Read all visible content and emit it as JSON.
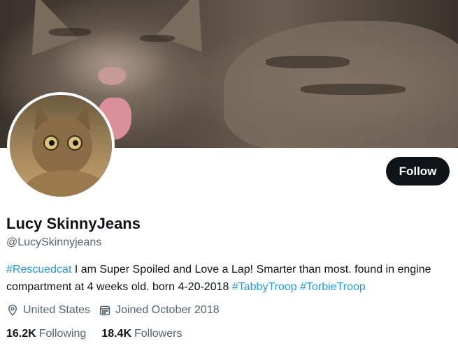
{
  "profile": {
    "display_name": "Lucy SkinnyJeans",
    "handle": "@LucySkinnyjeans",
    "follow_label": "Follow",
    "bio": {
      "tag1": "#Rescuedcat",
      "text1": " I am Super Spoiled and Love a Lap! Smarter than most. found in engine compartment at 4 weeks old. born 4-20-2018 ",
      "tag2": "#TabbyTroop",
      "space": " ",
      "tag3": "#TorbieTroop"
    },
    "location": "United States",
    "joined": "Joined October 2018",
    "following_count": "16.2K",
    "following_label": "Following",
    "followers_count": "18.4K",
    "followers_label": "Followers"
  },
  "icons": {
    "location": "location-pin-icon",
    "calendar": "calendar-icon"
  },
  "colors": {
    "link": "#1d9bf0",
    "muted": "#536471",
    "primary_text": "#0f1419",
    "button_bg": "#0f1419"
  }
}
